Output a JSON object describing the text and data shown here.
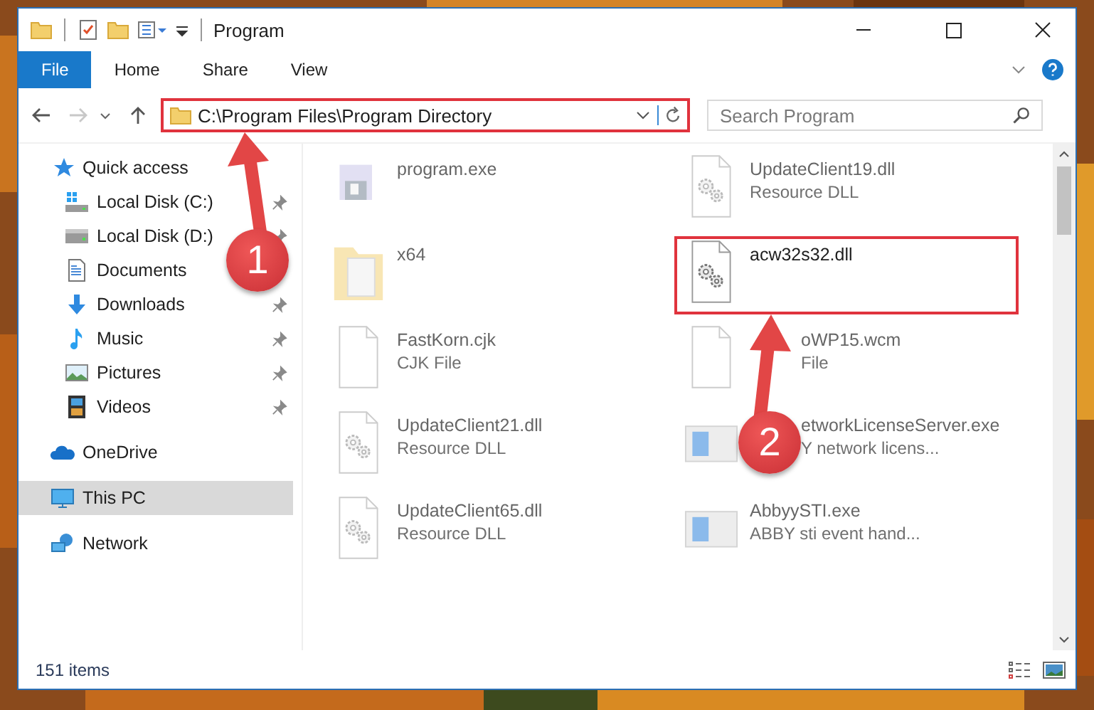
{
  "window": {
    "title": "Program"
  },
  "ribbon_tabs": [
    {
      "label": "File",
      "kind": "file-menu"
    },
    {
      "label": "Home",
      "kind": "tab"
    },
    {
      "label": "Share",
      "kind": "tab"
    },
    {
      "label": "View",
      "kind": "tab"
    }
  ],
  "address": {
    "path": "C:\\Program Files\\Program Directory",
    "highlighted": true
  },
  "search": {
    "placeholder": "Search Program"
  },
  "sidebar": {
    "items": [
      {
        "label": "Quick access",
        "kind": "star",
        "selected": false,
        "children": [
          {
            "label": "Local Disk (C:)",
            "kind": "disk-c",
            "pinned": true
          },
          {
            "label": "Local Disk (D:)",
            "kind": "disk",
            "pinned": true
          },
          {
            "label": "Documents",
            "kind": "documents"
          },
          {
            "label": "Downloads",
            "kind": "downloads",
            "pinned": true
          },
          {
            "label": "Music",
            "kind": "music",
            "pinned": true
          },
          {
            "label": "Pictures",
            "kind": "pictures",
            "pinned": true
          },
          {
            "label": "Videos",
            "kind": "videos",
            "pinned": true
          }
        ]
      },
      {
        "label": "OneDrive",
        "kind": "cloud",
        "selected": false
      },
      {
        "label": "This PC",
        "kind": "pc",
        "selected": true
      },
      {
        "label": "Network",
        "kind": "network",
        "selected": false
      }
    ]
  },
  "files": [
    {
      "name": "program.exe",
      "kind": "exe",
      "blurred": true,
      "covered": false
    },
    {
      "name": "UpdateClient19.dll",
      "type": "Resource DLL",
      "kind": "dll",
      "blurred": true,
      "covered": false
    },
    {
      "name": "x64",
      "kind": "folder",
      "blurred": true,
      "covered": false
    },
    {
      "name": "acw32s32.dll",
      "kind": "dll",
      "blurred": false,
      "highlighted": true,
      "covered": false
    },
    {
      "name": "FastKorn.cjk",
      "type": "CJK File",
      "kind": "file",
      "blurred": true,
      "covered": false
    },
    {
      "name": "oWP15.wcm",
      "type": "File",
      "kind": "file",
      "blurred": true,
      "covered": true
    },
    {
      "name": "UpdateClient21.dll",
      "type": "Resource DLL",
      "kind": "dll",
      "blurred": true,
      "covered": false
    },
    {
      "name": "etworkLicenseServer.exe",
      "type": "Y network licens...",
      "kind": "app",
      "blurred": true,
      "covered": true
    },
    {
      "name": "UpdateClient65.dll",
      "type": "Resource DLL",
      "kind": "dll",
      "blurred": true,
      "covered": false
    },
    {
      "name": "AbbyySTI.exe",
      "type": "ABBY sti event hand...",
      "kind": "app",
      "blurred": true,
      "covered": false
    }
  ],
  "status_bar": {
    "count": "151 items"
  },
  "annotations": [
    {
      "number": "1"
    },
    {
      "number": "2"
    }
  ]
}
